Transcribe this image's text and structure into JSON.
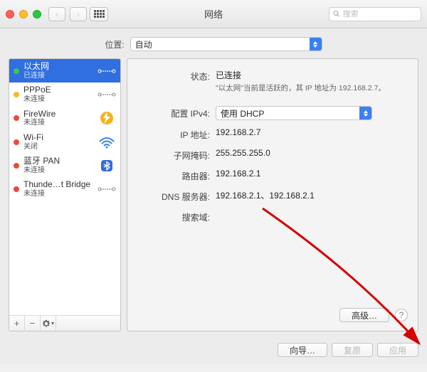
{
  "header": {
    "title": "网络",
    "search_placeholder": "搜索"
  },
  "location": {
    "label": "位置:",
    "value": "自动"
  },
  "sidebar": {
    "items": [
      {
        "name": "以太网",
        "sub": "已连接",
        "status": "green",
        "icon": "ethernet",
        "selected": true
      },
      {
        "name": "PPPoE",
        "sub": "未连接",
        "status": "yellow",
        "icon": "ethernet"
      },
      {
        "name": "FireWire",
        "sub": "未连接",
        "status": "red",
        "icon": "firewire"
      },
      {
        "name": "Wi-Fi",
        "sub": "关闭",
        "status": "red",
        "icon": "wifi"
      },
      {
        "name": "蓝牙 PAN",
        "sub": "未连接",
        "status": "red",
        "icon": "bluetooth"
      },
      {
        "name": "Thunde…t Bridge",
        "sub": "未连接",
        "status": "red",
        "icon": "ethernet"
      }
    ],
    "tools": {
      "add": "+",
      "remove": "−",
      "menu": "✻"
    }
  },
  "detail": {
    "status_label": "状态:",
    "status_value": "已连接",
    "status_sub": "\"以太网\"当前是活跃的，其 IP 地址为 192.168.2.7。",
    "config_label": "配置 IPv4:",
    "config_value": "使用 DHCP",
    "ip_label": "IP 地址:",
    "ip_value": "192.168.2.7",
    "mask_label": "子网掩码:",
    "mask_value": "255.255.255.0",
    "router_label": "路由器:",
    "router_value": "192.168.2.1",
    "dns_label": "DNS 服务器:",
    "dns_value": "192.168.2.1、192.168.2.1",
    "search_label": "搜索域:",
    "search_value": "",
    "advanced": "高级…",
    "help": "?"
  },
  "footer": {
    "wizard": "向导…",
    "revert": "复原",
    "apply": "应用"
  }
}
